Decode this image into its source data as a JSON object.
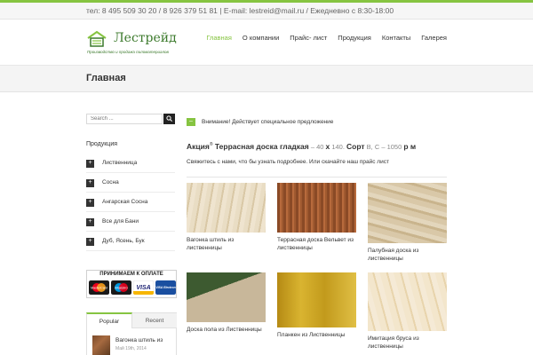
{
  "topbar": {
    "contact": "тел: 8 495 509 30 20 / 8 926 379 51 81 | E-mail: lestreid@mail.ru / Ежедневно с 8:30-18:00"
  },
  "logo": {
    "name": "Лестрейд",
    "subtitle": "Производство и продажа пиломатериалов"
  },
  "nav": {
    "items": [
      {
        "label": "Главная",
        "active": true
      },
      {
        "label": "О компании",
        "active": false
      },
      {
        "label": "Прайс- лист",
        "active": false
      },
      {
        "label": "Продукция",
        "active": false
      },
      {
        "label": "Контакты",
        "active": false
      },
      {
        "label": "Галерея",
        "active": false
      }
    ]
  },
  "page": {
    "title": "Главная"
  },
  "sidebar": {
    "search_placeholder": "Search ...",
    "heading": "Продукция",
    "categories": [
      {
        "label": "Лиственница"
      },
      {
        "label": "Сосна"
      },
      {
        "label": "Ангарская Сосна"
      },
      {
        "label": "Все для Бани"
      },
      {
        "label": "Дуб, Ясень, Бук"
      }
    ],
    "payment_title": "ПРИНИМАЕМ К ОПЛАТЕ",
    "cards": [
      "MasterCard",
      "Maestro",
      "VISA",
      "VISA Electron"
    ],
    "tabs": {
      "popular": "Popular",
      "recent": "Recent"
    },
    "recent_post": {
      "title": "Вагонка штиль из",
      "date": "Май 19th, 2014"
    }
  },
  "main": {
    "notice": "Внимание! Действует специальное предложение",
    "promo": {
      "lead": "Акция",
      "reg": "®",
      "product": "Террасная доска гладкая",
      "dims_1": " – 40 ",
      "times": "х",
      "dims_2": " 140. ",
      "grade_label": "Сорт",
      "grade_rest": " В, С – 1050 ",
      "unit": "р",
      "unit_2": " м"
    },
    "contact_line": "Свяжитесь с нами, что бы узнать подробнее. Или скачайте наш прайс лист",
    "products": [
      {
        "caption": "Вагонка штиль из лиственницы"
      },
      {
        "caption": "Террасная доска Вельвет из лиственницы"
      },
      {
        "caption": "Палубная доска из лиственницы"
      },
      {
        "caption": "Доска пола из Лиственницы"
      },
      {
        "caption": "Планкен из Лиственницы"
      },
      {
        "caption": "Имитация бруса из лиственницы"
      }
    ]
  },
  "colors": {
    "accent": "#86c441",
    "logo_green": "#3c7a2c"
  }
}
